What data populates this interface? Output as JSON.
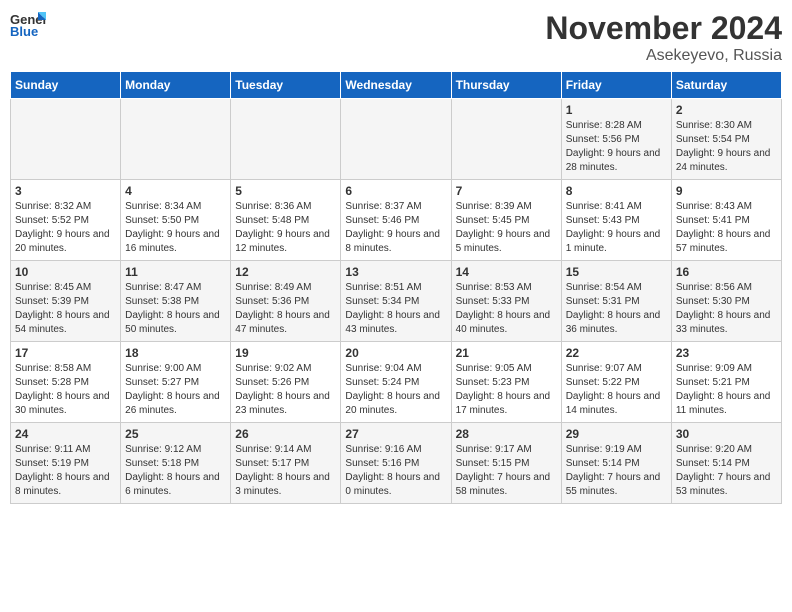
{
  "header": {
    "logo_line1": "General",
    "logo_line2": "Blue",
    "month": "November 2024",
    "location": "Asekeyevo, Russia"
  },
  "weekdays": [
    "Sunday",
    "Monday",
    "Tuesday",
    "Wednesday",
    "Thursday",
    "Friday",
    "Saturday"
  ],
  "rows": [
    [
      {
        "day": "",
        "info": ""
      },
      {
        "day": "",
        "info": ""
      },
      {
        "day": "",
        "info": ""
      },
      {
        "day": "",
        "info": ""
      },
      {
        "day": "",
        "info": ""
      },
      {
        "day": "1",
        "info": "Sunrise: 8:28 AM\nSunset: 5:56 PM\nDaylight: 9 hours and 28 minutes."
      },
      {
        "day": "2",
        "info": "Sunrise: 8:30 AM\nSunset: 5:54 PM\nDaylight: 9 hours and 24 minutes."
      }
    ],
    [
      {
        "day": "3",
        "info": "Sunrise: 8:32 AM\nSunset: 5:52 PM\nDaylight: 9 hours and 20 minutes."
      },
      {
        "day": "4",
        "info": "Sunrise: 8:34 AM\nSunset: 5:50 PM\nDaylight: 9 hours and 16 minutes."
      },
      {
        "day": "5",
        "info": "Sunrise: 8:36 AM\nSunset: 5:48 PM\nDaylight: 9 hours and 12 minutes."
      },
      {
        "day": "6",
        "info": "Sunrise: 8:37 AM\nSunset: 5:46 PM\nDaylight: 9 hours and 8 minutes."
      },
      {
        "day": "7",
        "info": "Sunrise: 8:39 AM\nSunset: 5:45 PM\nDaylight: 9 hours and 5 minutes."
      },
      {
        "day": "8",
        "info": "Sunrise: 8:41 AM\nSunset: 5:43 PM\nDaylight: 9 hours and 1 minute."
      },
      {
        "day": "9",
        "info": "Sunrise: 8:43 AM\nSunset: 5:41 PM\nDaylight: 8 hours and 57 minutes."
      }
    ],
    [
      {
        "day": "10",
        "info": "Sunrise: 8:45 AM\nSunset: 5:39 PM\nDaylight: 8 hours and 54 minutes."
      },
      {
        "day": "11",
        "info": "Sunrise: 8:47 AM\nSunset: 5:38 PM\nDaylight: 8 hours and 50 minutes."
      },
      {
        "day": "12",
        "info": "Sunrise: 8:49 AM\nSunset: 5:36 PM\nDaylight: 8 hours and 47 minutes."
      },
      {
        "day": "13",
        "info": "Sunrise: 8:51 AM\nSunset: 5:34 PM\nDaylight: 8 hours and 43 minutes."
      },
      {
        "day": "14",
        "info": "Sunrise: 8:53 AM\nSunset: 5:33 PM\nDaylight: 8 hours and 40 minutes."
      },
      {
        "day": "15",
        "info": "Sunrise: 8:54 AM\nSunset: 5:31 PM\nDaylight: 8 hours and 36 minutes."
      },
      {
        "day": "16",
        "info": "Sunrise: 8:56 AM\nSunset: 5:30 PM\nDaylight: 8 hours and 33 minutes."
      }
    ],
    [
      {
        "day": "17",
        "info": "Sunrise: 8:58 AM\nSunset: 5:28 PM\nDaylight: 8 hours and 30 minutes."
      },
      {
        "day": "18",
        "info": "Sunrise: 9:00 AM\nSunset: 5:27 PM\nDaylight: 8 hours and 26 minutes."
      },
      {
        "day": "19",
        "info": "Sunrise: 9:02 AM\nSunset: 5:26 PM\nDaylight: 8 hours and 23 minutes."
      },
      {
        "day": "20",
        "info": "Sunrise: 9:04 AM\nSunset: 5:24 PM\nDaylight: 8 hours and 20 minutes."
      },
      {
        "day": "21",
        "info": "Sunrise: 9:05 AM\nSunset: 5:23 PM\nDaylight: 8 hours and 17 minutes."
      },
      {
        "day": "22",
        "info": "Sunrise: 9:07 AM\nSunset: 5:22 PM\nDaylight: 8 hours and 14 minutes."
      },
      {
        "day": "23",
        "info": "Sunrise: 9:09 AM\nSunset: 5:21 PM\nDaylight: 8 hours and 11 minutes."
      }
    ],
    [
      {
        "day": "24",
        "info": "Sunrise: 9:11 AM\nSunset: 5:19 PM\nDaylight: 8 hours and 8 minutes."
      },
      {
        "day": "25",
        "info": "Sunrise: 9:12 AM\nSunset: 5:18 PM\nDaylight: 8 hours and 6 minutes."
      },
      {
        "day": "26",
        "info": "Sunrise: 9:14 AM\nSunset: 5:17 PM\nDaylight: 8 hours and 3 minutes."
      },
      {
        "day": "27",
        "info": "Sunrise: 9:16 AM\nSunset: 5:16 PM\nDaylight: 8 hours and 0 minutes."
      },
      {
        "day": "28",
        "info": "Sunrise: 9:17 AM\nSunset: 5:15 PM\nDaylight: 7 hours and 58 minutes."
      },
      {
        "day": "29",
        "info": "Sunrise: 9:19 AM\nSunset: 5:14 PM\nDaylight: 7 hours and 55 minutes."
      },
      {
        "day": "30",
        "info": "Sunrise: 9:20 AM\nSunset: 5:14 PM\nDaylight: 7 hours and 53 minutes."
      }
    ]
  ]
}
